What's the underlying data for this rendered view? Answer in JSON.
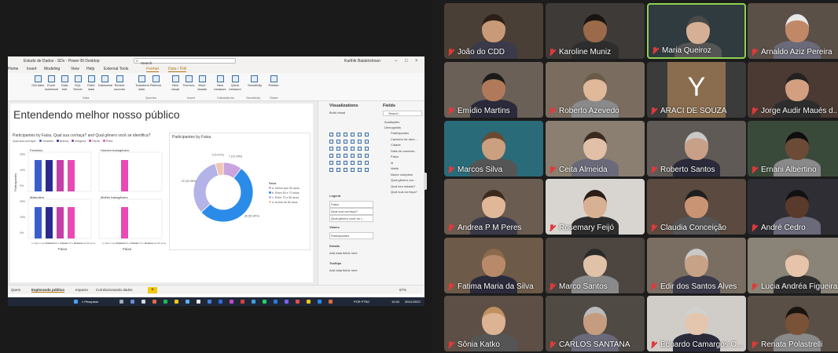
{
  "powerbi": {
    "window_title": "Estudo de Dados - SDx - Power BI Desktop",
    "search_placeholder": "Search",
    "user": "Karthik Balakrishnan",
    "menu": [
      "Home",
      "Insert",
      "Modeling",
      "View",
      "Help",
      "External Tools",
      "Format",
      "Data / Drill"
    ],
    "menu_active": "Format",
    "ribbon_items": [
      "Get data",
      "Excel workbook",
      "Data hub",
      "SQL Server",
      "Enter data",
      "Dataverse",
      "Recent sources",
      "Transform data",
      "Refresh",
      "New visual",
      "Text box",
      "More visuals",
      "New measure",
      "Quick measure",
      "Sensitivity",
      "Publish"
    ],
    "ribbon_groups": [
      "Data",
      "Queries",
      "Insert",
      "Calculations",
      "Sensitivity",
      "Share"
    ],
    "page_title": "Entendendo melhor nosso público",
    "visual1_title": "Participantes by Faixa, Qual sua cor/raça? and Qual gênero você se identifica?",
    "visual1_legend_label": "Qual sua cor/raça?",
    "visual1_legend": [
      {
        "name": "Amarelo",
        "color": "#3a5fcd"
      },
      {
        "name": "Branca",
        "color": "#2b2b8f"
      },
      {
        "name": "Indígena",
        "color": "#7a3fa0"
      },
      {
        "name": "Parda",
        "color": "#c43fa8"
      },
      {
        "name": "Preta",
        "color": "#e84ab5"
      }
    ],
    "small_multiples": [
      {
        "label": "Feminino"
      },
      {
        "label": "Homem transgênero"
      },
      {
        "label": "Masculino"
      },
      {
        "label": "Mulher transgênero"
      }
    ],
    "visual1_ylabel": "Participantes",
    "visual1_xlabel": "Faixa",
    "visual1_yticks": [
      "20%",
      "10%",
      "0%"
    ],
    "visual1_xcats": [
      "a. Menor que 50 anos",
      "b. Entre 50 e 70 anos",
      "c. Entre 70 e 80 anos",
      "d. Acima de 80 anos"
    ],
    "visual2_title": "Participantes by Faixa",
    "visual2_legend_title": "Faixa",
    "visual2_legend": [
      {
        "name": "a. Menor que 50 anos",
        "color": "#c9a4e0"
      },
      {
        "name": "b. Entre 50 e 70 anos",
        "color": "#2b8be8"
      },
      {
        "name": "c. Entre 70 e 80 anos",
        "color": "#b3b3e8"
      },
      {
        "name": "d. Acima de 80 anos",
        "color": "#f2c4b0"
      }
    ],
    "visual2_labels": [
      "7 (10.29%)",
      "3 (4.41%)",
      "22 (32.35%)",
      "36 (52.94%)"
    ],
    "panes": {
      "visualizations": "Visualizations",
      "fields": "Fields",
      "build_visual": "Build visual",
      "search": "Search",
      "legend_label": "Legend",
      "legend_fields": [
        "Faixa",
        "Qual sua cor/raça?",
        "Qual gênero você se i..."
      ],
      "values_label": "Values",
      "values_fields": [
        "Participantes"
      ],
      "details_label": "Details",
      "details_add": "Add data fields here",
      "tooltips_label": "Tooltips",
      "tooltips_add": "Add data fields here",
      "field_tables": [
        "Avaliações",
        "Demografia"
      ],
      "field_items": [
        "Participantes",
        "Caminho de dem...",
        "Cidade",
        "Data de nascime...",
        "Faixa",
        "id",
        "Idade",
        "Nome completo",
        "Qual gênero voc...",
        "Qual seu estado?",
        "Qual sua cor/raça?"
      ]
    },
    "tabs": [
      "Quem",
      "Explorando público",
      "Impacto",
      "Correlacionando dados"
    ],
    "tab_active": "Explorando público",
    "zoom": "67%",
    "taskbar": {
      "search": "Pesquisar",
      "lang": "POR PTB2",
      "time": "10:40",
      "date": "30/11/2022"
    }
  },
  "chart_data": [
    {
      "type": "bar",
      "title": "Participantes by Faixa, Qual sua cor/raça? and Qual gênero você se identifica?",
      "xlabel": "Faixa",
      "ylabel": "Participantes",
      "categories": [
        "Feminino",
        "Homem transgênero",
        "Masculino",
        "Mulher transgênero"
      ],
      "series": [
        {
          "name": "Amarelo",
          "values": [
            20,
            0,
            20,
            0
          ]
        },
        {
          "name": "Branca",
          "values": [
            20,
            0,
            20,
            0
          ]
        },
        {
          "name": "Parda",
          "values": [
            20,
            20,
            20,
            20
          ]
        },
        {
          "name": "Preta",
          "values": [
            20,
            0,
            20,
            0
          ]
        }
      ],
      "ylim": [
        0,
        20
      ]
    },
    {
      "type": "pie",
      "title": "Participantes by Faixa",
      "categories": [
        "a. Menor que 50 anos",
        "b. Entre 50 e 70 anos",
        "c. Entre 70 e 80 anos",
        "d. Acima de 80 anos"
      ],
      "values": [
        7,
        36,
        22,
        3
      ],
      "labels": [
        "7 (10.29%)",
        "36 (52.94%)",
        "22 (32.35%)",
        "3 (4.41%)"
      ]
    }
  ],
  "participants": [
    "João do CDD",
    "Karoline Muniz",
    "Maria Queiroz",
    "Arnaldo Aziz Pereira",
    "Emídio Martins",
    "Roberto Azevedo",
    "ARACI DE SOUZA",
    "Jorge Audir Maués d...",
    "Marcos Silva",
    "Ceita Almeida",
    "Roberto Santos",
    "Ernani Albertino",
    "Andrea P M Peres",
    "Rosemary Feijó",
    "Claudia Conceição",
    "André Cedro",
    "Fatima Maria da Silva",
    "Marco Santos",
    "Edir dos Santos Alves",
    "Lucia Andréa Figueira",
    "Sônia Katko",
    "CARLOS SANTANA",
    "Eduardo Camargos C...",
    "Renata Polastrelli"
  ],
  "araci_initial": "Y",
  "active_speaker": "Maria Queiroz"
}
